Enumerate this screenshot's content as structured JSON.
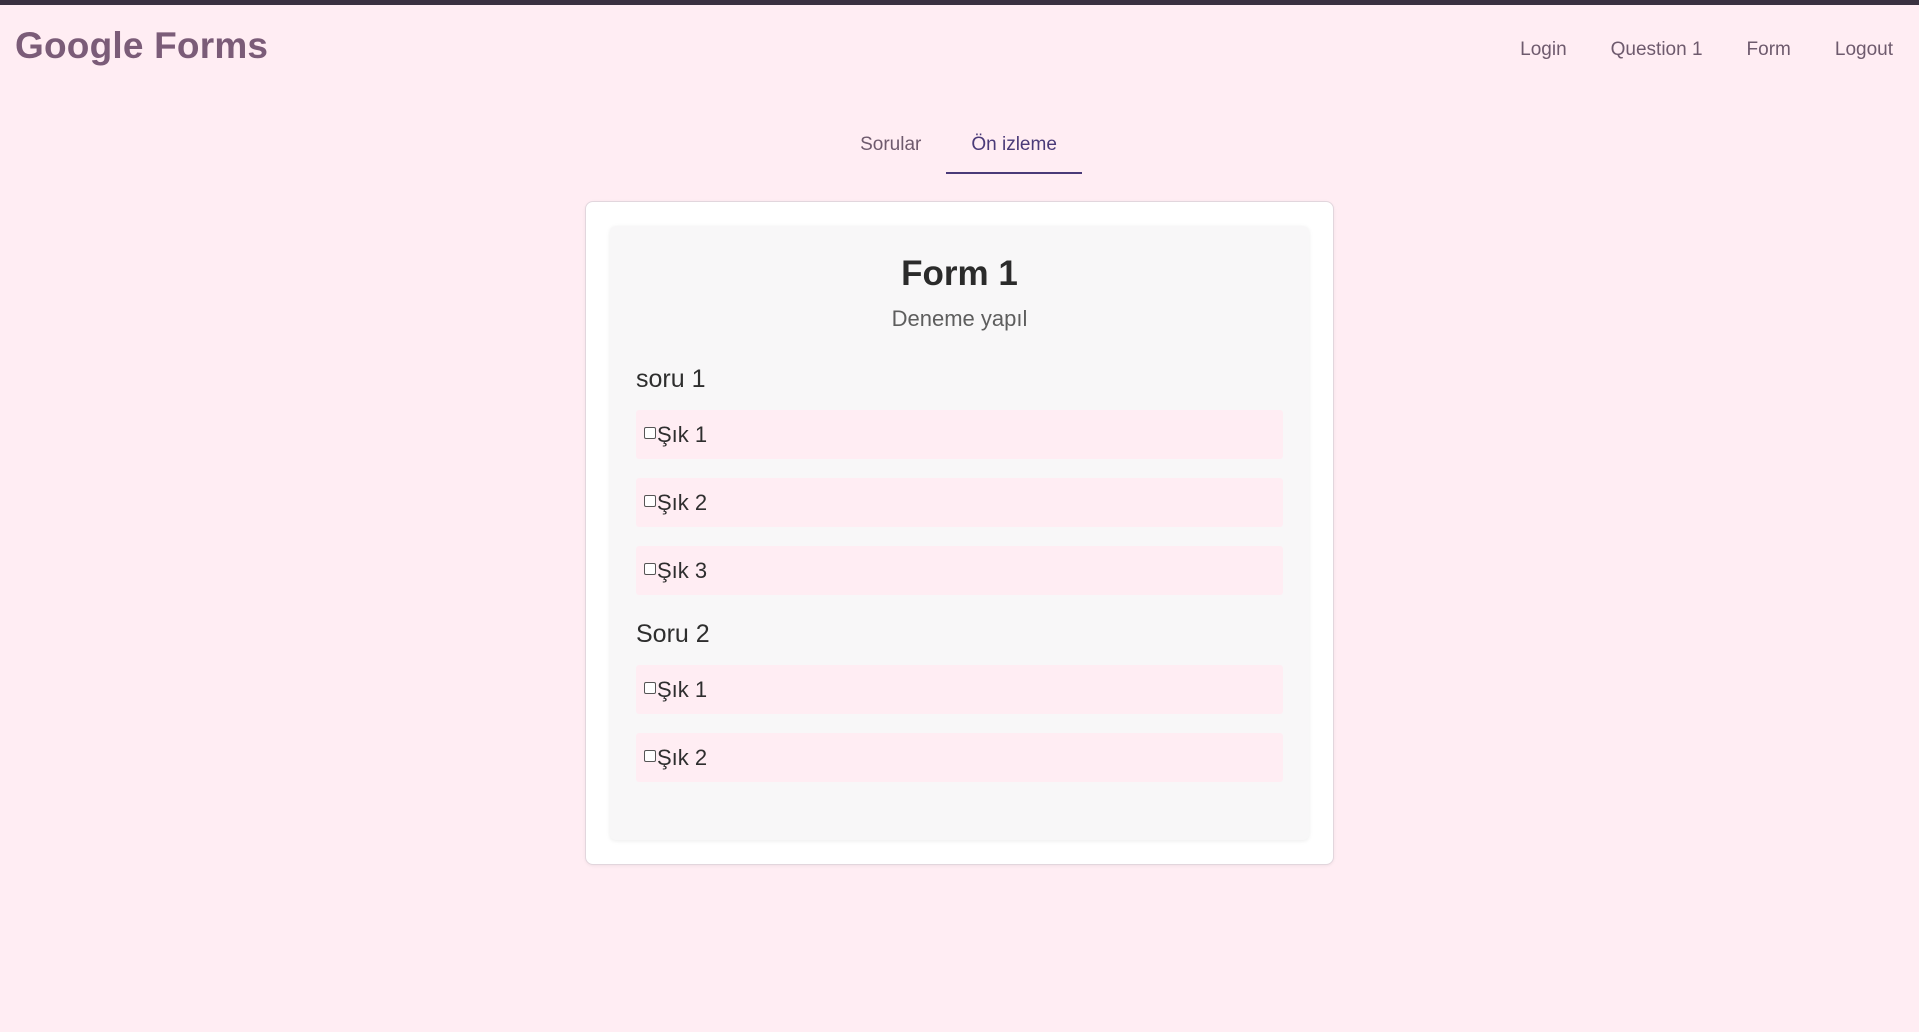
{
  "brand": "Google Forms",
  "nav": {
    "links": [
      "Login",
      "Question 1",
      "Form",
      "Logout"
    ]
  },
  "tabs": [
    {
      "label": "Sorular",
      "active": false
    },
    {
      "label": "Ön izleme",
      "active": true
    }
  ],
  "form": {
    "title": "Form 1",
    "description": "Deneme yapıl",
    "questions": [
      {
        "title": "soru 1",
        "options": [
          "Şık 1",
          "Şık 2",
          "Şık 3"
        ]
      },
      {
        "title": "Soru 2",
        "options": [
          "Şık 1",
          "Şık 2"
        ]
      }
    ]
  },
  "colors": {
    "background": "#ffedf3",
    "brand": "#7b5c78",
    "active_tab": "#4a3a78"
  }
}
